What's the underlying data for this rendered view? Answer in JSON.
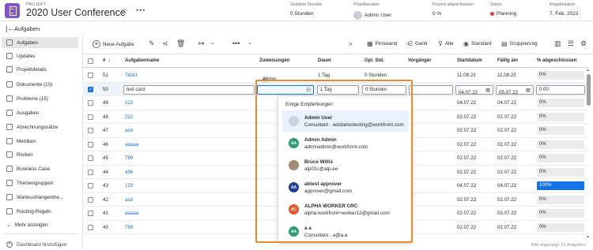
{
  "header": {
    "project_label": "PROJEKT",
    "title": "2020 User Conference",
    "meta": [
      {
        "label": "Geplante Stunden",
        "value": "0 Stunden"
      },
      {
        "label": "Projektbesitzer",
        "value": "Admin User"
      },
      {
        "label": "Prozent abgeschlossen",
        "value": "0 %"
      },
      {
        "label": "Status",
        "value": "Planning"
      },
      {
        "label": "Eingabedatum",
        "value": "7. Feb. 2022"
      }
    ]
  },
  "subheader": {
    "title": "Aufgaben"
  },
  "sidebar": {
    "items": [
      "Aufgaben",
      "Updates",
      "Projektdetails",
      "Dokumente (10)",
      "Probleme (15)",
      "Ausgaben",
      "Abrechnungssätze",
      "Metriken",
      "Risiken",
      "Business Case",
      "Themengruppen",
      "Warteschlangenthe...",
      "Routing-Regeln",
      "Mehr anzeigen",
      "Dashboard hinzufügen"
    ]
  },
  "toolbar": {
    "new_task": "Neue Aufgabe",
    "pinnwand": "Pinnwand",
    "gantt": "Gantt",
    "alle": "Alle",
    "standard": "Standard",
    "gruppierung": "Gruppierung"
  },
  "columns": {
    "num": "#",
    "name": "Aufgabenname",
    "assign": "Zuweisungen",
    "duration": "Dauer",
    "planned": "Gpl. Std.",
    "pred": "Vorgänger",
    "start": "Startdatum",
    "due": "Fällig am",
    "pct": "% abgeschlossen"
  },
  "rows": [
    {
      "num": "51",
      "name": "Task1",
      "assign": "Admin User",
      "duration": "1 Tag",
      "planned": "0 Stunden",
      "start": "11.08.23",
      "due": "11.08.23",
      "pct": "0%"
    },
    {
      "num": "50",
      "name": "test card",
      "assign": "",
      "duration": "1 Tag",
      "planned": "0 Stunden",
      "start": "04.07.22",
      "due": "05.07.22",
      "pct": "0.00"
    },
    {
      "num": "49",
      "name": "222",
      "start": "04.07.22",
      "due": "04.07.22",
      "pct": "0%"
    },
    {
      "num": "48",
      "name": "222",
      "start": "02.07.22",
      "due": "02.07.22",
      "pct": "0%"
    },
    {
      "num": "47",
      "name": "asd",
      "start": "02.07.22",
      "due": "02.07.22",
      "pct": "0%"
    },
    {
      "num": "46",
      "name": "aaaaa",
      "start": "02.07.22",
      "due": "02.07.22",
      "pct": "0%"
    },
    {
      "num": "45",
      "name": "789",
      "start": "02.07.22",
      "due": "02.07.22",
      "pct": "0%"
    },
    {
      "num": "44",
      "name": "456",
      "start": "02.07.22",
      "due": "02.07.22",
      "pct": "0%"
    },
    {
      "num": "43",
      "name": "123",
      "start": "04.07.22",
      "due": "04.07.22",
      "pct": "100%"
    },
    {
      "num": "42",
      "name": "asd",
      "start": "02.07.22",
      "due": "02.07.22",
      "pct": "0%"
    },
    {
      "num": "41",
      "name": "aaaaa",
      "start": "02.07.22",
      "due": "02.07.22",
      "pct": "0%"
    },
    {
      "num": "40",
      "name": "789",
      "start": "02.07.22",
      "due": "02.07.22",
      "pct": "0%"
    }
  ],
  "dropdown": {
    "heading": "Einige Empfehlungen",
    "options": [
      {
        "initials": "",
        "name": "Admin User",
        "sub": "Consultant  ·  adobeloctesting@workfront.com",
        "color": "#c9d3dd"
      },
      {
        "initials": "AA",
        "name": "Admin Admin",
        "sub": "adminadmin@workfront.com",
        "color": "#2d9d78"
      },
      {
        "initials": "",
        "name": "Bruce Willis",
        "sub": "alp02c@alp.ee",
        "color": "#a58a73"
      },
      {
        "initials": "AA",
        "name": "abtest approver",
        "sub": "approver@gmail.com",
        "color": "#1e3f9a"
      },
      {
        "initials": "AC",
        "name": "ALPHA WORKER CRC",
        "sub": "alpha.workfront+worker12@gmail.com",
        "color": "#e5562b"
      },
      {
        "initials": "AA",
        "name": "a a",
        "sub": "Consultant  ·  a@a.a",
        "color": "#2d9d78"
      }
    ]
  },
  "footer": {
    "text": "Bild angezeigt: 51 Aufgaben"
  }
}
